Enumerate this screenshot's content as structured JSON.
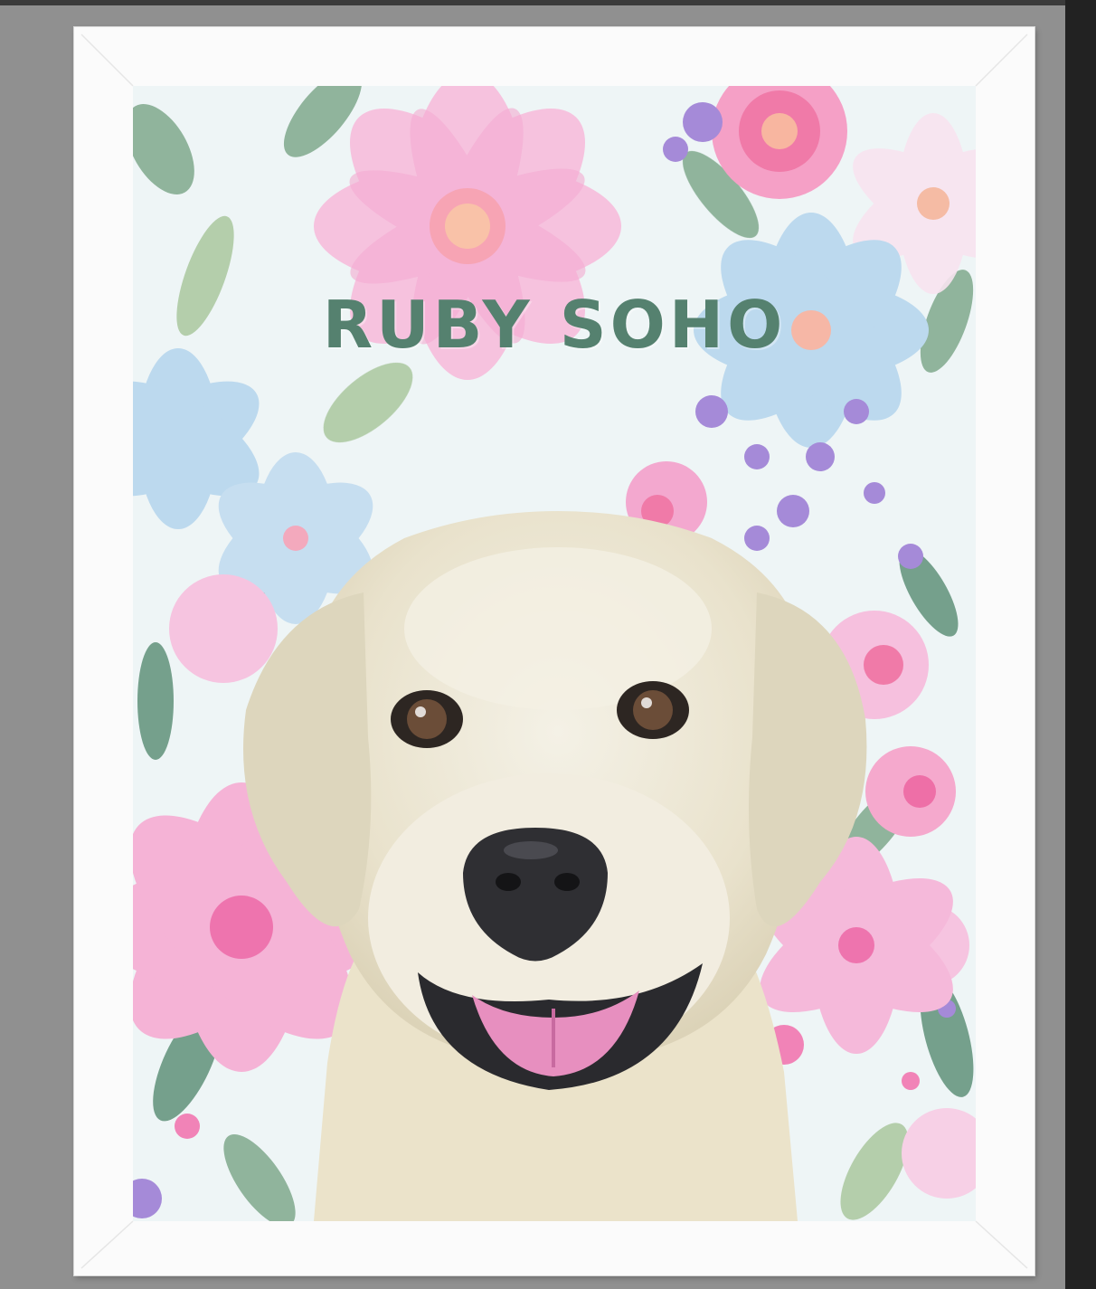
{
  "poster": {
    "title": "RUBY SOHO",
    "title_color": "#55816f"
  },
  "artwork": {
    "subject_icon": "dog-portrait",
    "background_icon": "floral-pattern",
    "palette": {
      "pink": "#f4b9dc",
      "hot_pink": "#ee6fa7",
      "light_blue": "#b9d8ee",
      "lavender": "#a58ad8",
      "leaf_green": "#6f9b80",
      "fur": "#ece6d2",
      "nose": "#2f2f33",
      "tongue": "#e78fbf"
    }
  },
  "frame": {
    "color": "#fbfbfb"
  }
}
